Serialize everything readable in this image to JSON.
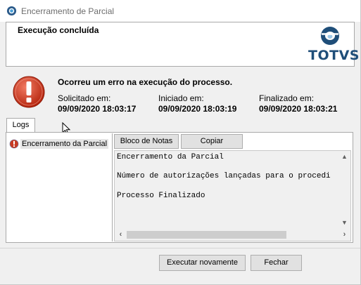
{
  "window": {
    "title": "Encerramento de Parcial"
  },
  "header": {
    "title": "Execução concluída",
    "logo_text": "TOTVS"
  },
  "status": {
    "message": "Ocorreu um erro na execução do processo.",
    "requested_label": "Solicitado em:",
    "requested_value": "09/09/2020 18:03:17",
    "started_label": "Iniciado em:",
    "started_value": "09/09/2020 18:03:19",
    "finished_label": "Finalizado em:",
    "finished_value": "09/09/2020 18:03:21"
  },
  "tabs": [
    {
      "label": "Logs"
    }
  ],
  "tree": {
    "items": [
      {
        "label": "Encerramento da Parcial"
      }
    ]
  },
  "log_toolbar": {
    "notepad_label": "Bloco de Notas",
    "copy_label": "Copiar"
  },
  "log_lines": [
    "Encerramento da Parcial",
    "Número de autorizações lançadas para o procedi",
    "Processo Finalizado"
  ],
  "footer": {
    "retry_label": "Executar novamente",
    "close_label": "Fechar"
  },
  "colors": {
    "logo_blue": "#1f4e79",
    "error_red": "#d9412b"
  }
}
